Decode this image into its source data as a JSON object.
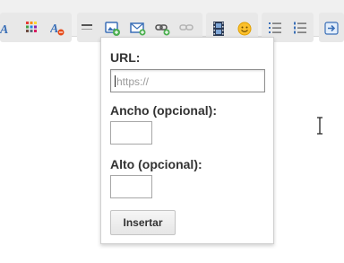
{
  "toolbar": {
    "icons": [
      "text-color-icon",
      "background-color-icon",
      "remove-format-icon",
      "horizontal-rule-icon",
      "insert-image-icon",
      "email-link-icon",
      "insert-link-icon",
      "unlink-icon",
      "insert-video-icon",
      "emoticon-icon",
      "bulleted-list-icon",
      "numbered-list-icon",
      "indent-icon"
    ]
  },
  "popup": {
    "url_label": "URL:",
    "url_placeholder": "https://",
    "width_label": "Ancho (opcional):",
    "height_label": "Alto (opcional):",
    "insert_button": "Insertar"
  },
  "colors": {
    "toolbar_bg": "#f0f0f0",
    "button_group_bg": "#e8e8e8",
    "popup_border": "#d0d0d0",
    "icon_blue": "#3a6fb7",
    "icon_green": "#4caf50"
  }
}
